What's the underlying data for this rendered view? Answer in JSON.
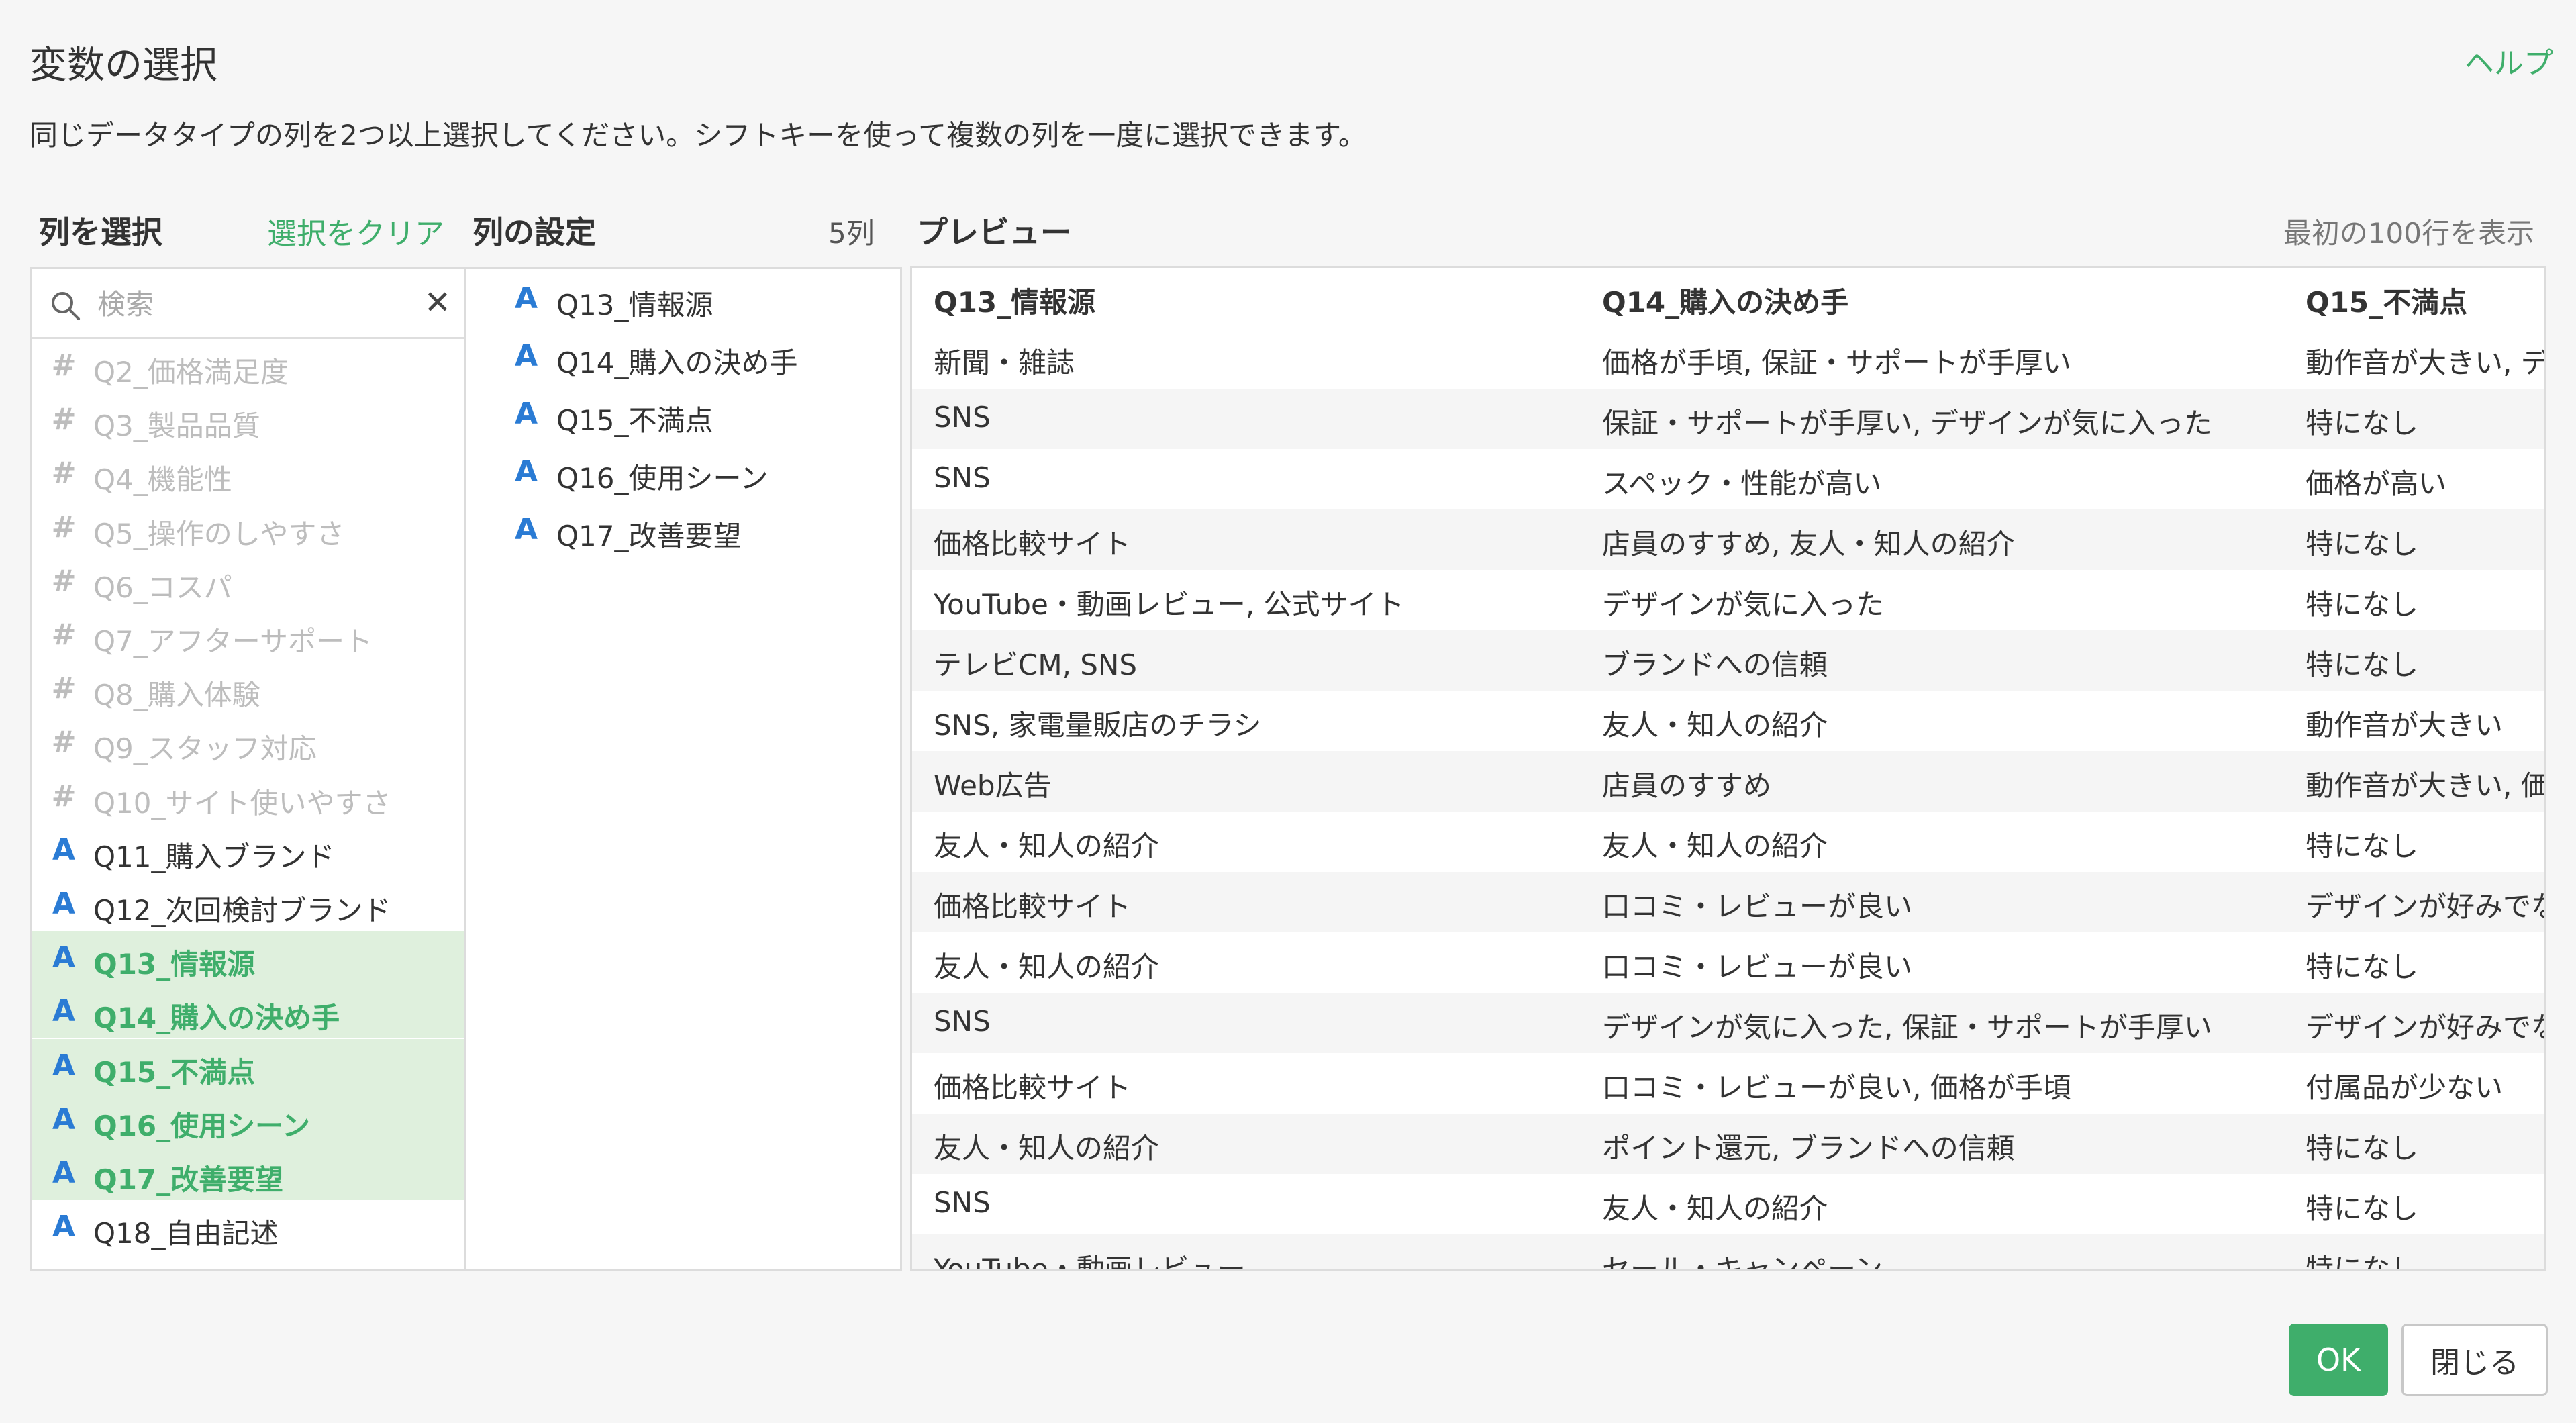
{
  "dialog": {
    "title": "変数の選択",
    "help": "ヘルプ",
    "description": "同じデータタイプの列を2つ以上選択してください。シフトキーを使って複数の列を一度に選択できます。"
  },
  "column_select": {
    "heading": "列を選択",
    "clear_label": "選択をクリア",
    "search_placeholder": "検索",
    "items": [
      {
        "type": "#",
        "label": "Q2_価格満足度",
        "state": "disabled"
      },
      {
        "type": "#",
        "label": "Q3_製品品質",
        "state": "disabled"
      },
      {
        "type": "#",
        "label": "Q4_機能性",
        "state": "disabled"
      },
      {
        "type": "#",
        "label": "Q5_操作のしやすさ",
        "state": "disabled"
      },
      {
        "type": "#",
        "label": "Q6_コスパ",
        "state": "disabled"
      },
      {
        "type": "#",
        "label": "Q7_アフターサポート",
        "state": "disabled"
      },
      {
        "type": "#",
        "label": "Q8_購入体験",
        "state": "disabled"
      },
      {
        "type": "#",
        "label": "Q9_スタッフ対応",
        "state": "disabled"
      },
      {
        "type": "#",
        "label": "Q10_サイト使いやすさ",
        "state": "disabled"
      },
      {
        "type": "A",
        "label": "Q11_購入ブランド",
        "state": "normal"
      },
      {
        "type": "A",
        "label": "Q12_次回検討ブランド",
        "state": "normal"
      },
      {
        "type": "A",
        "label": "Q13_情報源",
        "state": "selected"
      },
      {
        "type": "A",
        "label": "Q14_購入の決め手",
        "state": "selected"
      },
      {
        "type": "A",
        "label": "Q15_不満点",
        "state": "selected"
      },
      {
        "type": "A",
        "label": "Q16_使用シーン",
        "state": "selected"
      },
      {
        "type": "A",
        "label": "Q17_改善要望",
        "state": "selected"
      },
      {
        "type": "A",
        "label": "Q18_自由記述",
        "state": "normal"
      }
    ]
  },
  "column_settings": {
    "heading": "列の設定",
    "count": "5列",
    "items": [
      {
        "type": "A",
        "label": "Q13_情報源"
      },
      {
        "type": "A",
        "label": "Q14_購入の決め手"
      },
      {
        "type": "A",
        "label": "Q15_不満点"
      },
      {
        "type": "A",
        "label": "Q16_使用シーン"
      },
      {
        "type": "A",
        "label": "Q17_改善要望"
      }
    ]
  },
  "preview": {
    "heading": "プレビュー",
    "rows_note": "最初の100行を表示",
    "columns": [
      "Q13_情報源",
      "Q14_購入の決め手",
      "Q15_不満点"
    ],
    "rows": [
      [
        "新聞・雑誌",
        "価格が手頃, 保証・サポートが手厚い",
        "動作音が大きい, デ"
      ],
      [
        "SNS",
        "保証・サポートが手厚い, デザインが気に入った",
        "特になし"
      ],
      [
        "SNS",
        "スペック・性能が高い",
        "価格が高い"
      ],
      [
        "価格比較サイト",
        "店員のすすめ, 友人・知人の紹介",
        "特になし"
      ],
      [
        "YouTube・動画レビュー, 公式サイト",
        "デザインが気に入った",
        "特になし"
      ],
      [
        "テレビCM, SNS",
        "ブランドへの信頼",
        "特になし"
      ],
      [
        "SNS, 家電量販店のチラシ",
        "友人・知人の紹介",
        "動作音が大きい"
      ],
      [
        "Web広告",
        "店員のすすめ",
        "動作音が大きい, 価"
      ],
      [
        "友人・知人の紹介",
        "友人・知人の紹介",
        "特になし"
      ],
      [
        "価格比較サイト",
        "口コミ・レビューが良い",
        "デザインが好みでな"
      ],
      [
        "友人・知人の紹介",
        "口コミ・レビューが良い",
        "特になし"
      ],
      [
        "SNS",
        "デザインが気に入った, 保証・サポートが手厚い",
        "デザインが好みでな"
      ],
      [
        "価格比較サイト",
        "口コミ・レビューが良い, 価格が手頃",
        "付属品が少ない"
      ],
      [
        "友人・知人の紹介",
        "ポイント還元, ブランドへの信頼",
        "特になし"
      ],
      [
        "SNS",
        "友人・知人の紹介",
        "特になし"
      ],
      [
        "YouTube・動画レビュー",
        "セール・キャンペーン",
        "特になし"
      ]
    ]
  },
  "buttons": {
    "ok": "OK",
    "close": "閉じる"
  },
  "colors": {
    "accent": "#3fae6b",
    "type_text_icon": "#2a7bd4",
    "selected_bg": "#dff0dd"
  }
}
